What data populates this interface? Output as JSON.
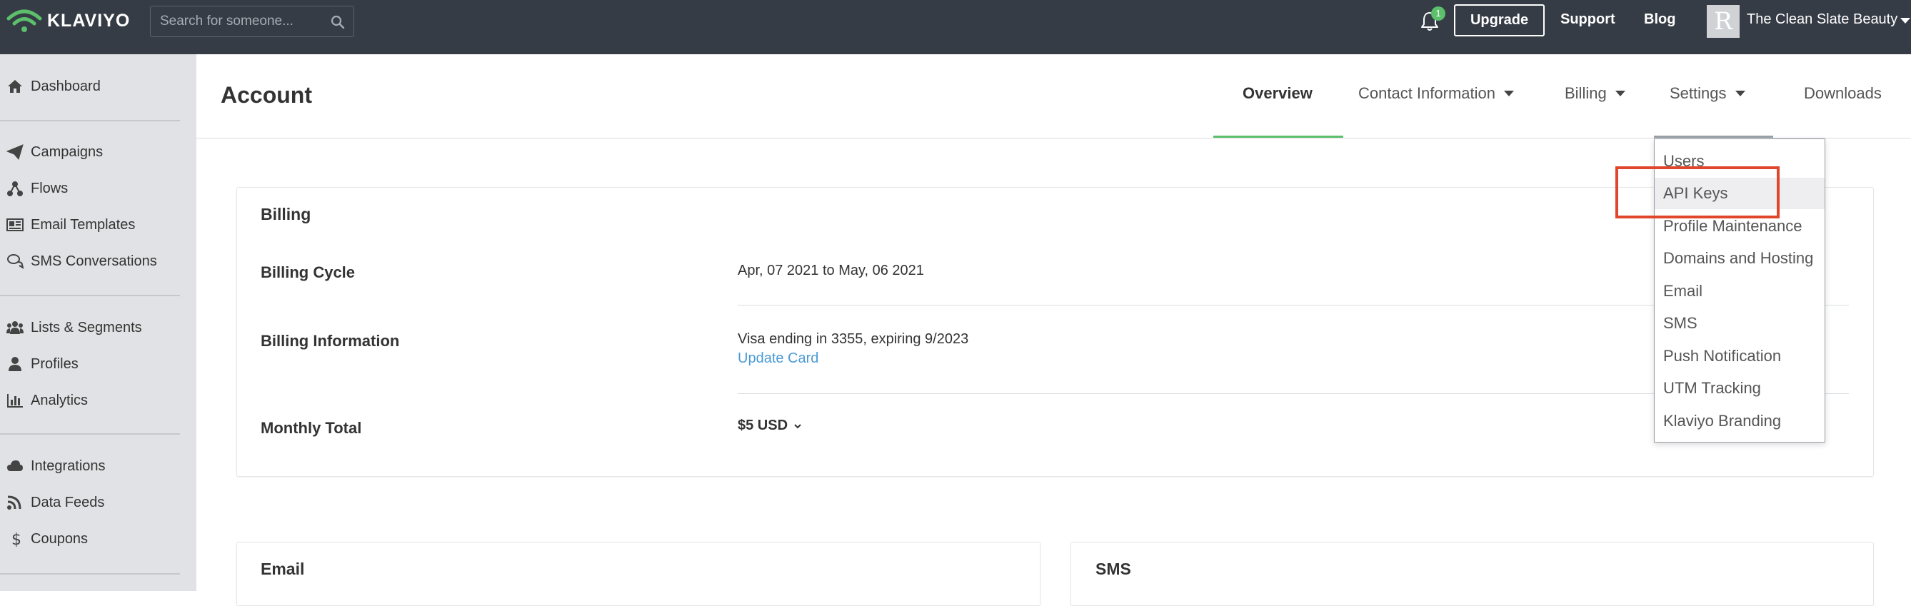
{
  "topbar": {
    "brand": "KLAVIYO",
    "search_placeholder": "Search for someone...",
    "notification_count": "1",
    "upgrade_label": "Upgrade",
    "support_label": "Support",
    "blog_label": "Blog",
    "avatar_initial": "R",
    "account_name": "The Clean Slate Beauty"
  },
  "sidebar": {
    "items": [
      {
        "label": "Dashboard",
        "icon": "home-icon"
      },
      {
        "label": "Campaigns",
        "icon": "paper-plane-icon"
      },
      {
        "label": "Flows",
        "icon": "flow-icon"
      },
      {
        "label": "Email Templates",
        "icon": "template-icon"
      },
      {
        "label": "SMS Conversations",
        "icon": "chat-icon"
      },
      {
        "label": "Lists & Segments",
        "icon": "users-icon"
      },
      {
        "label": "Profiles",
        "icon": "user-icon"
      },
      {
        "label": "Analytics",
        "icon": "bar-chart-icon"
      },
      {
        "label": "Integrations",
        "icon": "cloud-icon"
      },
      {
        "label": "Data Feeds",
        "icon": "rss-icon"
      },
      {
        "label": "Coupons",
        "icon": "dollar-icon"
      }
    ]
  },
  "header": {
    "title": "Account",
    "tabs": [
      {
        "label": "Overview",
        "active": true
      },
      {
        "label": "Contact Information",
        "dropdown": true
      },
      {
        "label": "Billing",
        "dropdown": true
      },
      {
        "label": "Settings",
        "dropdown": true
      },
      {
        "label": "Downloads"
      }
    ]
  },
  "billing": {
    "title": "Billing",
    "rows": [
      {
        "label": "Billing Cycle",
        "value": "Apr, 07 2021 to May, 06 2021"
      },
      {
        "label": "Billing Information",
        "value": "Visa ending in 3355, expiring 9/2023",
        "link": "Update Card"
      },
      {
        "label": "Monthly Total",
        "value": "$5 USD"
      }
    ]
  },
  "email_card": {
    "title": "Email"
  },
  "sms_card": {
    "title": "SMS"
  },
  "settings_menu": {
    "items": [
      "Users",
      "API Keys",
      "Profile Maintenance",
      "Domains and Hosting",
      "Email",
      "SMS",
      "Push Notification",
      "UTM Tracking",
      "Klaviyo Branding"
    ],
    "highlighted": "API Keys"
  },
  "colors": {
    "topbar": "#363c45",
    "sidebar": "#e1e2e5",
    "accent_green": "#5cbf6b",
    "link_blue": "#4a9ad6",
    "annotation_red": "#e0462c"
  }
}
